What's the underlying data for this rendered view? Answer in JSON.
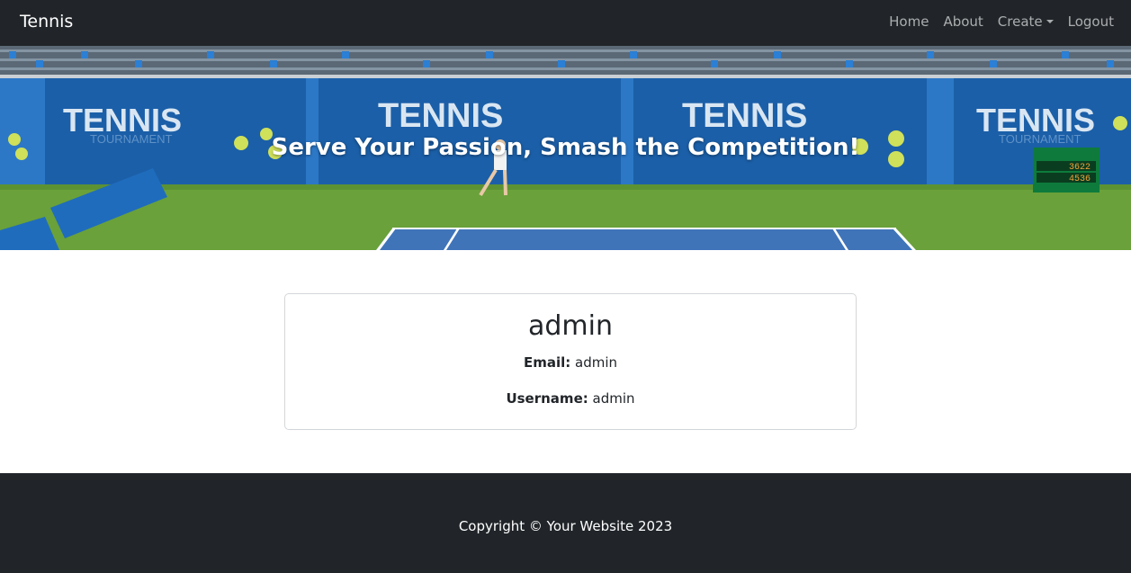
{
  "navbar": {
    "brand": "Tennis",
    "links": [
      {
        "label": "Home"
      },
      {
        "label": "About"
      },
      {
        "label": "Create"
      },
      {
        "label": "Logout"
      }
    ]
  },
  "hero": {
    "title": "Serve Your Passion, Smash the Competition!",
    "banner_text": "TENNIS",
    "banner_subtext": "TOURNAMENT",
    "scoreboard": {
      "row1": "3622",
      "row2": "4536"
    }
  },
  "profile": {
    "name": "admin",
    "email_label": "Email:",
    "email_value": "admin",
    "username_label": "Username:",
    "username_value": "admin"
  },
  "footer": {
    "copyright": "Copyright © Your Website 2023"
  },
  "colors": {
    "navbar_bg": "#212529",
    "banner_blue": "#1b5fa8",
    "court_green": "#6aa13a",
    "court_blue": "#3f74b9"
  }
}
